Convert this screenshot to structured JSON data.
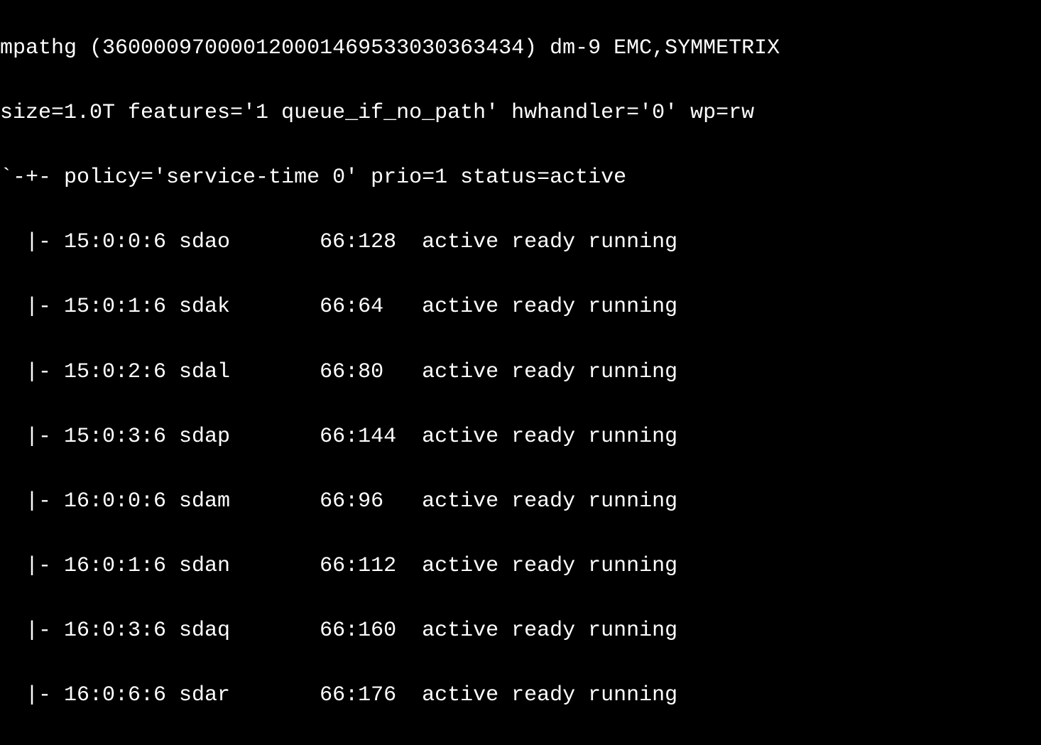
{
  "multipath": {
    "header": "mpathg (360000970000120001469533030363434) dm-9 EMC,SYMMETRIX",
    "sizeline": "size=1.0T features='1 queue_if_no_path' hwhandler='0' wp=rw",
    "policyline": "`-+- policy='service-time 0' prio=1 status=active",
    "paths": [
      "  |- 15:0:0:6 sdao       66:128  active ready running",
      "  |- 15:0:1:6 sdak       66:64   active ready running",
      "  |- 15:0:2:6 sdal       66:80   active ready running",
      "  |- 15:0:3:6 sdap       66:144  active ready running",
      "  |- 16:0:0:6 sdam       66:96   active ready running",
      "  |- 16:0:1:6 sdan       66:112  active ready running",
      "  |- 16:0:3:6 sdaq       66:160  active ready running",
      "  |- 16:0:6:6 sdar       66:176  active ready running"
    ]
  }
}
